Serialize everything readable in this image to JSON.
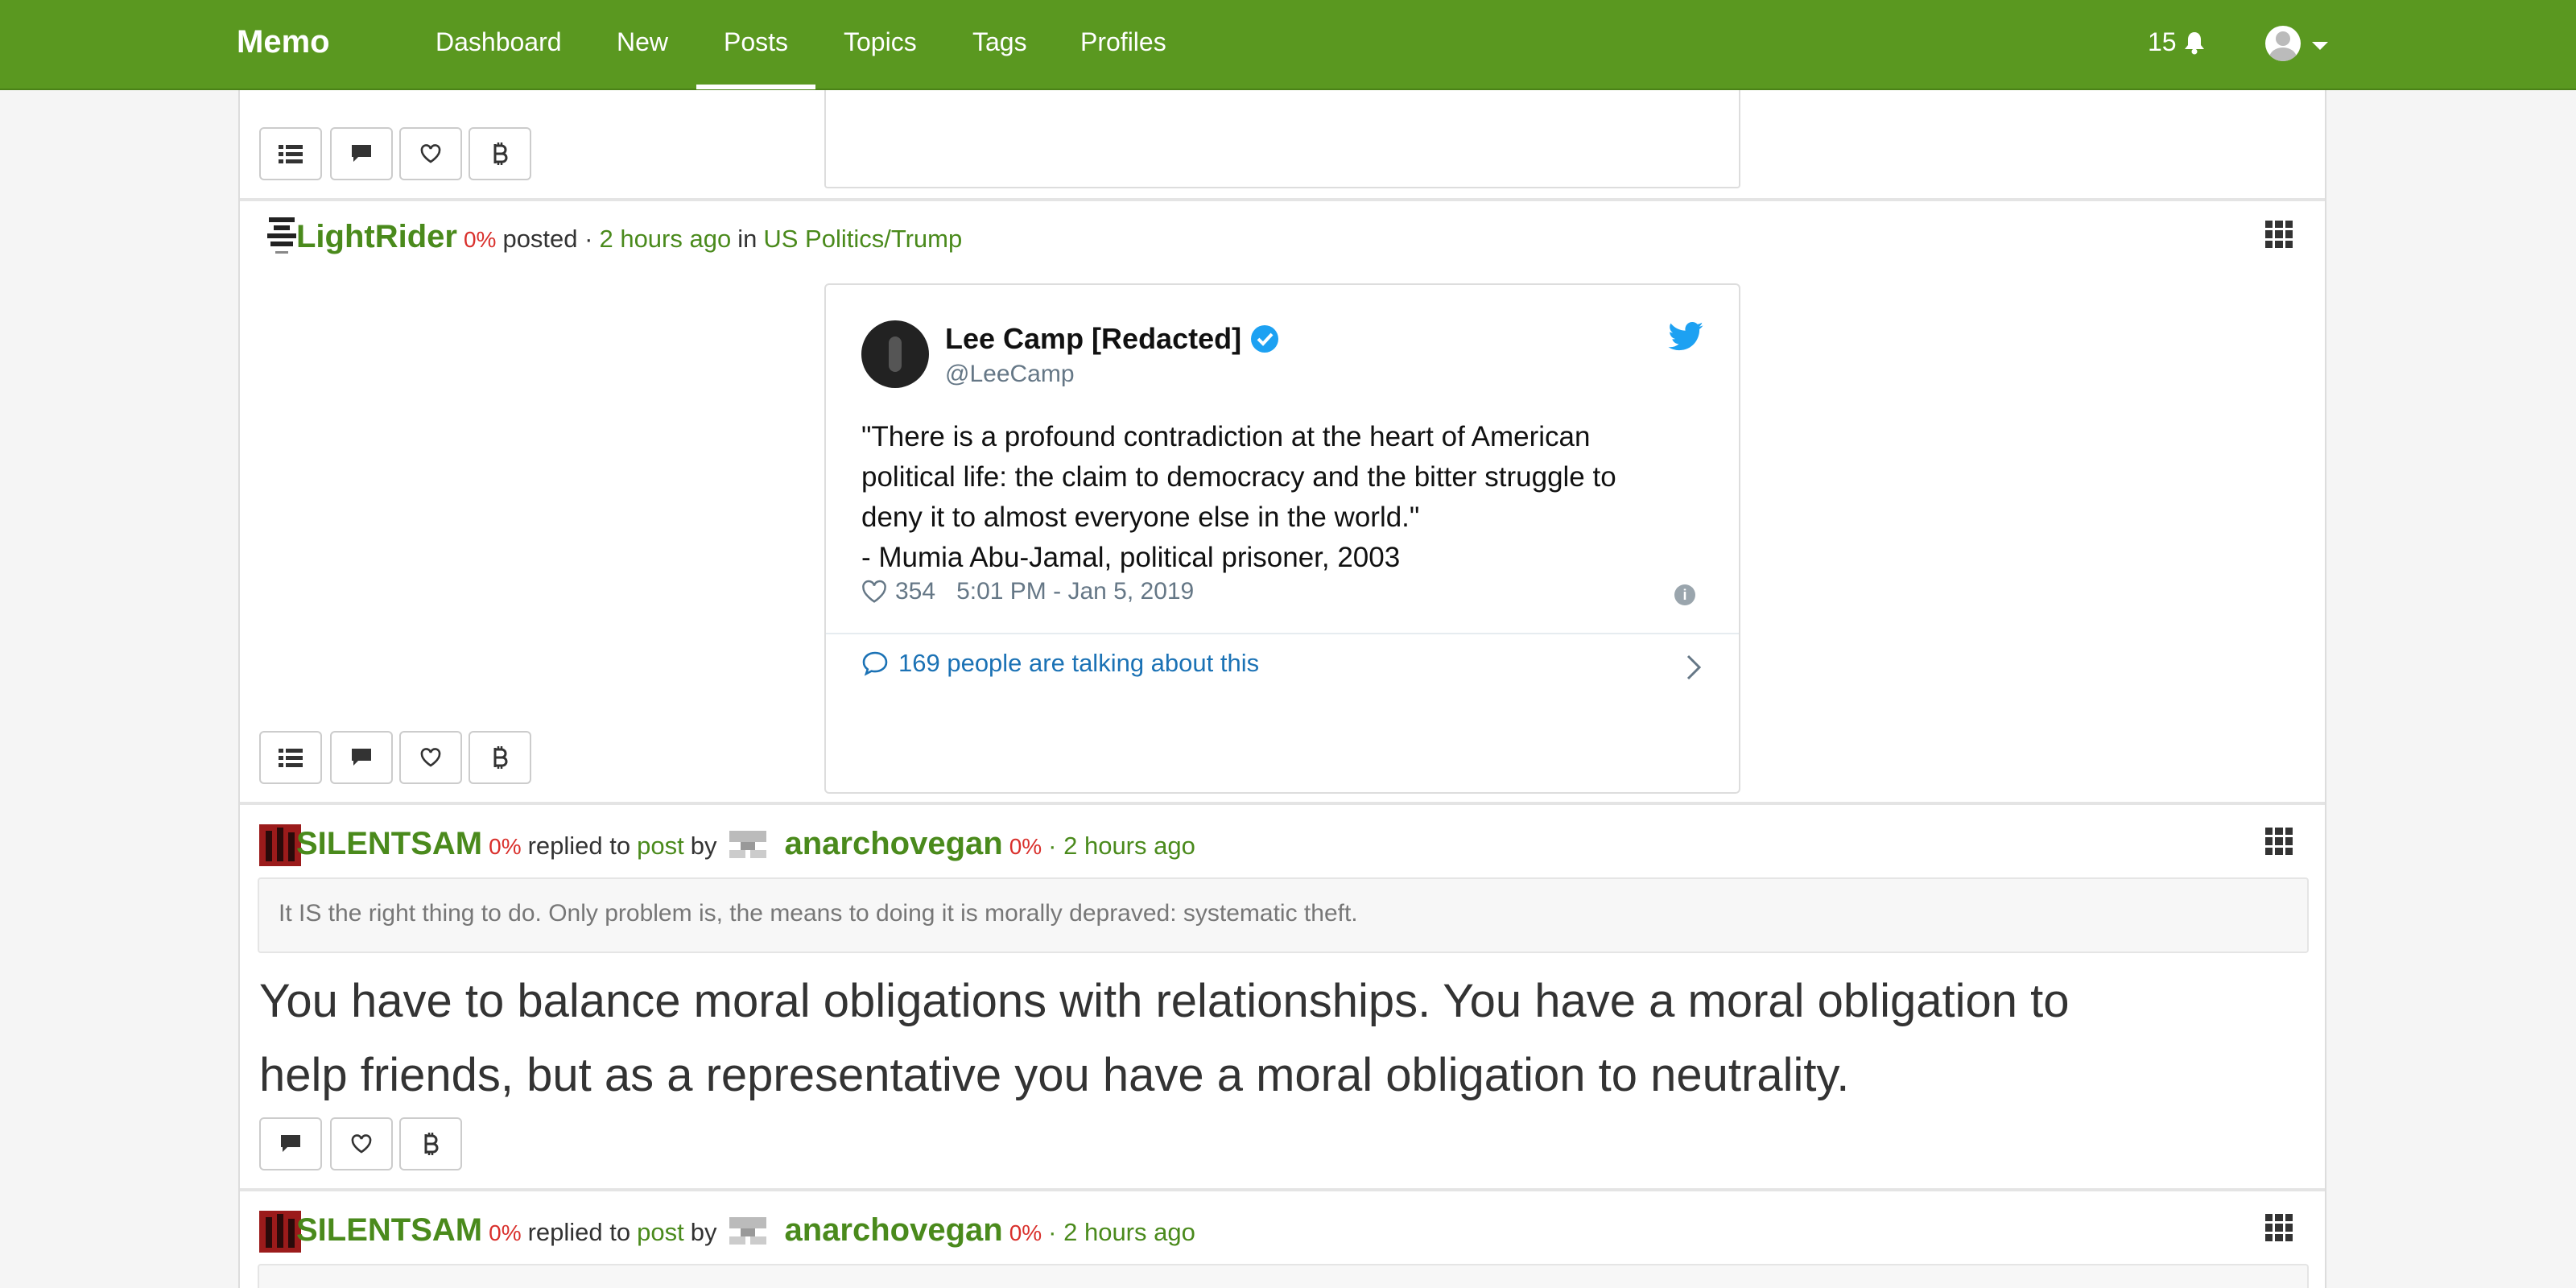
{
  "nav": {
    "brand": "Memo",
    "items": [
      "Dashboard",
      "New",
      "Posts",
      "Topics",
      "Tags",
      "Profiles"
    ],
    "active": "Posts",
    "notifications": "15"
  },
  "posts": [
    {
      "user": "LightRider",
      "percent": "0%",
      "action": "posted ·",
      "time": "2 hours ago",
      "in": "in",
      "topic": "US Politics/Trump",
      "tweet": {
        "name": "Lee Camp [Redacted]",
        "handle": "@LeeCamp",
        "lines": [
          "\"There is a profound contradiction at the heart of American",
          "political life: the claim to democracy and the bitter struggle to",
          "deny it to almost everyone else in the world.\"",
          "- Mumia Abu-Jamal, political prisoner, 2003"
        ],
        "likes": "354",
        "date": "5:01 PM - Jan 5, 2019",
        "talking": "169 people are talking about this"
      }
    },
    {
      "user": "SILENTSAM",
      "percent": "0%",
      "action": "replied to",
      "post_link": "post",
      "by": "by",
      "target_user": "anarchovegan",
      "target_percent": "0%",
      "time": "· 2 hours ago",
      "quote": "It IS the right thing to do. Only problem is, the means to doing it is morally depraved: systematic theft.",
      "text_lines": [
        "You have to balance moral obligations with relationships. You have a moral obligation to",
        "help friends, but as a representative you have a moral obligation to neutrality."
      ]
    },
    {
      "user": "SILENTSAM",
      "percent": "0%",
      "action": "replied to",
      "post_link": "post",
      "by": "by",
      "target_user": "anarchovegan",
      "target_percent": "0%",
      "time": "· 2 hours ago"
    }
  ],
  "colors": {
    "nav_bg": "#5a9820",
    "user_green": "#4a8a1c",
    "percent_red": "#d9302c",
    "twitter_blue": "#1da1f2"
  }
}
